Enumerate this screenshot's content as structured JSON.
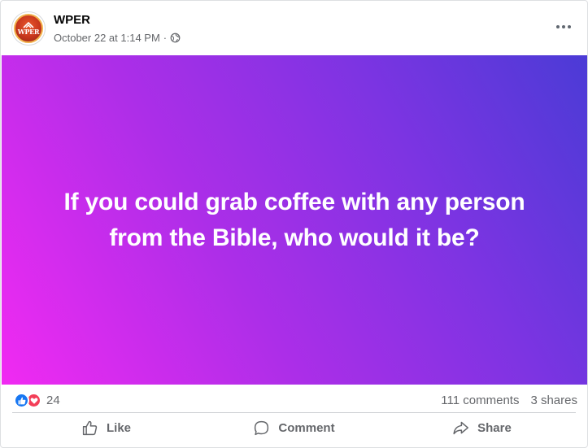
{
  "post": {
    "page_name": "WPER",
    "avatar_text": "WPER",
    "timestamp": "October 22 at 1:14 PM",
    "separator": "·",
    "audience_icon": "globe-icon",
    "menu_icon": "more-options-icon",
    "background": {
      "gradient_start": "#f12af2",
      "gradient_mid": "#ad2ee8",
      "gradient_end": "#4b3bd6"
    },
    "text_lines": [
      "If you could grab coffee with any person",
      "from the Bible, who would it be?"
    ]
  },
  "stats": {
    "reaction_icons": [
      "like-reaction-icon",
      "love-reaction-icon"
    ],
    "reaction_count": "24",
    "comments": "111 comments",
    "shares": "3 shares"
  },
  "actions": {
    "like": "Like",
    "comment": "Comment",
    "share": "Share"
  },
  "colors": {
    "secondary_text": "#65676b",
    "like_blue": "#1877f2",
    "love_red": "#f33e58",
    "divider": "#ced0d4"
  }
}
